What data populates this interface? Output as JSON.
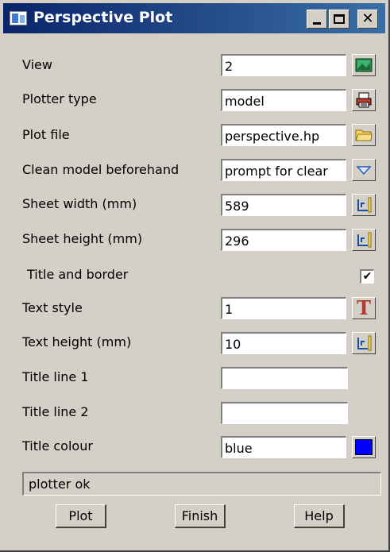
{
  "window": {
    "title": "Perspective Plot",
    "close_glyph": "✕"
  },
  "fields": {
    "view": {
      "label": "View",
      "value": "2",
      "icon": "view-picture-icon"
    },
    "plotter_type": {
      "label": "Plotter type",
      "value": "model",
      "icon": "printer-icon"
    },
    "plot_file": {
      "label": "Plot file",
      "value": "perspective.hp",
      "icon": "folder-icon"
    },
    "clean_model": {
      "label": "Clean model beforehand",
      "value": "prompt for clear",
      "icon": "dropdown-arrow-icon"
    },
    "sheet_width": {
      "label": "Sheet width  (mm)",
      "value": "589",
      "icon": "ruler-icon"
    },
    "sheet_height": {
      "label": "Sheet height (mm)",
      "value": "296",
      "icon": "ruler-icon"
    },
    "title_border": {
      "label": "Title and border",
      "checked": true,
      "check_glyph": "✔"
    },
    "text_style": {
      "label": "Text style",
      "value": "1",
      "icon": "text-style-icon",
      "icon_glyph": "T"
    },
    "text_height": {
      "label": "Text height (mm)",
      "value": "10",
      "icon": "ruler-icon"
    },
    "title_line_1": {
      "label": "Title line 1",
      "value": ""
    },
    "title_line_2": {
      "label": "Title line 2",
      "value": ""
    },
    "title_colour": {
      "label": "Title colour",
      "value": "blue",
      "swatch_color": "#0000ff"
    }
  },
  "status": {
    "message": "plotter ok"
  },
  "buttons": {
    "plot": "Plot",
    "finish": "Finish",
    "help": "Help"
  },
  "colors": {
    "titlebar": "#0a246a",
    "dialog_bg": "#d4d0c8"
  }
}
